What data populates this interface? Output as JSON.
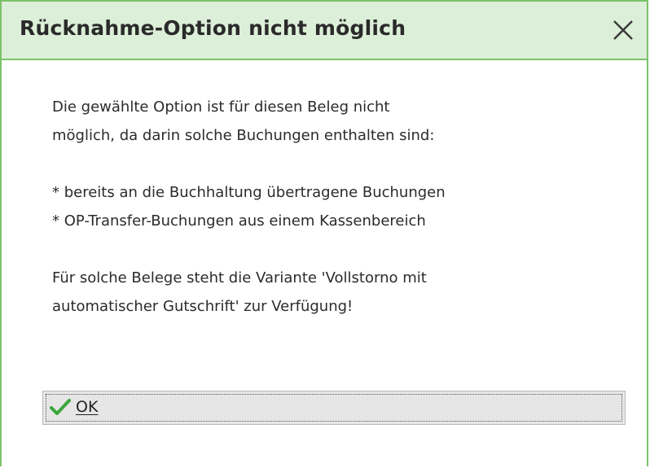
{
  "dialog": {
    "title": "Rücknahme-Option nicht möglich",
    "close_icon": "close-icon",
    "message": {
      "line1": "Die gewählte Option ist für diesen Beleg nicht",
      "line2": "möglich, da darin solche Buchungen enthalten sind:",
      "bullet1": "* bereits an die Buchhaltung übertragene Buchungen",
      "bullet2": "* OP-Transfer-Buchungen aus einem Kassenbereich",
      "line3": "Für solche Belege steht die Variante 'Vollstorno mit",
      "line4": "automatischer Gutschrift' zur Verfügung!"
    },
    "ok_button": {
      "label": "OK",
      "icon": "checkmark-icon"
    }
  },
  "colors": {
    "titlebar_bg": "#dcefd8",
    "border_green": "#7cc26b",
    "check_green": "#3aa63a",
    "button_bg": "#e6e6e6"
  }
}
